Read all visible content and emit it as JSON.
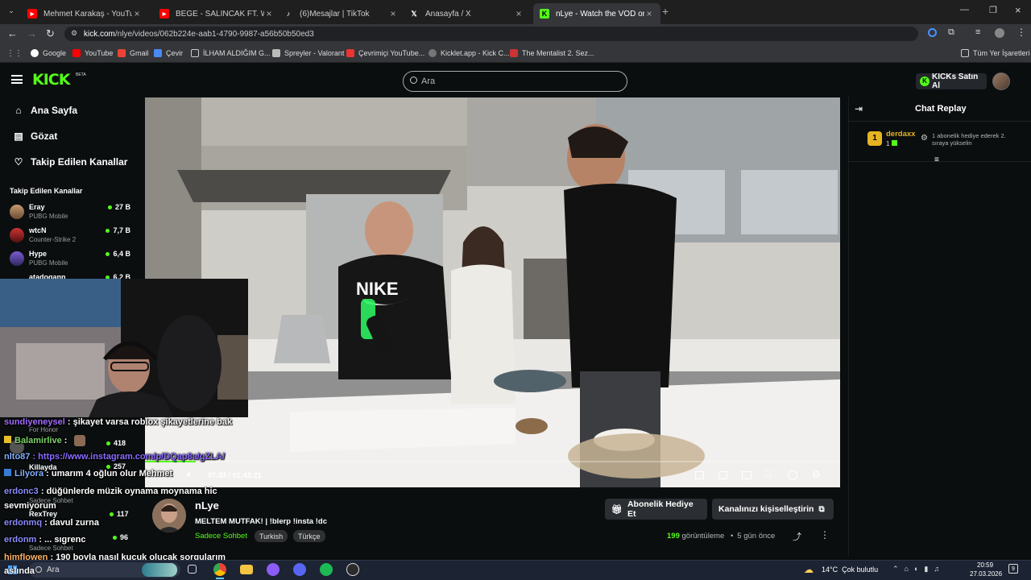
{
  "browser": {
    "tabs": [
      {
        "title": "Mehmet Karakaş - YouTube",
        "icon": "youtube-icon"
      },
      {
        "title": "BEGE - SALINCAK FT. WEGH, O",
        "icon": "youtube-icon"
      },
      {
        "title": "(6)Mesajlar | TikTok",
        "icon": "tiktok-icon"
      },
      {
        "title": "Anasayfa / X",
        "icon": "x-icon"
      },
      {
        "title": "nLye - Watch the VOD on Kick",
        "icon": "kick-icon",
        "active": true
      }
    ],
    "url_host": "kick.com",
    "url_path": "/nlye/videos/062b224e-aab1-4790-9987-a56b50b50ed3",
    "bookmarks": [
      "Google",
      "YouTube",
      "Gmail",
      "Çevir",
      "İLHAM ALDIĞIM G...",
      "Spreyler - Valorant",
      "Çevrimiçi YouTube...",
      "Kicklet.app - Kick C...",
      "The Mentalist 2. Sez..."
    ],
    "all_bookmarks": "Tüm Yer İşaretleri"
  },
  "header": {
    "logo": "KICK",
    "beta": "BETA",
    "search_placeholder": "Ara",
    "buy_kicks": "KICKs Satın Al"
  },
  "sidebar": {
    "nav": [
      {
        "label": "Ana Sayfa",
        "icon": "home-icon"
      },
      {
        "label": "Gözat",
        "icon": "browse-icon"
      },
      {
        "label": "Takip Edilen Kanallar",
        "icon": "heart-icon"
      }
    ],
    "followed_title": "Takip Edilen Kanallar",
    "channels": [
      {
        "name": "Eray",
        "game": "PUBG Mobile",
        "viewers": "27 B"
      },
      {
        "name": "wtcN",
        "game": "Counter-Strike 2",
        "viewers": "7,7 B"
      },
      {
        "name": "Hype",
        "game": "PUBG Mobile",
        "viewers": "6,4 B"
      },
      {
        "name": "atadogann",
        "game": "",
        "viewers": "6,2 B"
      }
    ],
    "hidden_channels": [
      {
        "name": "",
        "game": "For Honor",
        "viewers": ""
      },
      {
        "name": "",
        "game": "",
        "viewers": "418"
      },
      {
        "name": "Killayda",
        "game": "",
        "viewers": "257"
      },
      {
        "name": "",
        "game": "Sadece Sohbet",
        "viewers": ""
      },
      {
        "name": "RexTrey",
        "game": "",
        "viewers": "117"
      },
      {
        "name": "",
        "game": "Sadece Sohbet",
        "viewers": "96"
      }
    ]
  },
  "overlay_chat": [
    {
      "user": "sundiyeneysel",
      "text": " : şikayet varsa roblox şikayetlerine bak",
      "color": "#a26bff"
    },
    {
      "user": "Balamirlive",
      "text": " : ",
      "color": "#7fd36a"
    },
    {
      "user": "nlto87",
      "text": " : https://www.instagram.com/p/DQap8a/gZLA/",
      "color": "#7fb0ff",
      "text_color": "#8a6bff"
    },
    {
      "user": "Lilyora",
      "text": " : umarım 4 oğlun olur Mehmet",
      "color": "#7fb0ff"
    },
    {
      "user": "erdonc3",
      "text": " : düğünlerde müzik oynama moynama hic",
      "color": "#8a8cff"
    },
    {
      "user": "",
      "text": "sevmiyorum",
      "color": "#fff"
    },
    {
      "user": "erdonmq",
      "text": " : davul zurna",
      "color": "#8a8cff"
    },
    {
      "user": "erdonm",
      "text": " : ... sıgrenc",
      "color": "#8a8cff"
    },
    {
      "user": "himflowen",
      "text": " : 190 boyla nasıl kucuk olucak sorgularım",
      "color": "#ffb266"
    },
    {
      "user": "",
      "text": "aslında",
      "color": "#fff"
    }
  ],
  "video": {
    "time_current": "07:33",
    "time_sep": "/",
    "time_total": "01:43:21"
  },
  "stream": {
    "streamer": "nLye",
    "title": "MELTEM MUTFAK! | !blerp !insta !dc",
    "chat_mode": "Sadece Sohbet",
    "tags": [
      "Turkish",
      "Türkçe"
    ],
    "gift_button": "Abonelik Hediye Et",
    "customize_button": "Kanalınızı kişiselleştirin",
    "views_num": "199",
    "views_label": " görüntüleme",
    "ago": "5 gün önce"
  },
  "chat": {
    "title": "Chat Replay",
    "leader_rank": "1",
    "leader_name": "derdaxx",
    "leader_count": "1",
    "promo": "1 abonelik hediye ederek 2. sıraya yükselin"
  },
  "taskbar": {
    "search": "Ara",
    "weather": "14°C  Çok bulutlu",
    "time": "20:59",
    "date": "27.03.2026",
    "notifications": "9"
  },
  "colors": {
    "kick_green": "#53fc18",
    "background": "#0b0e0f"
  }
}
